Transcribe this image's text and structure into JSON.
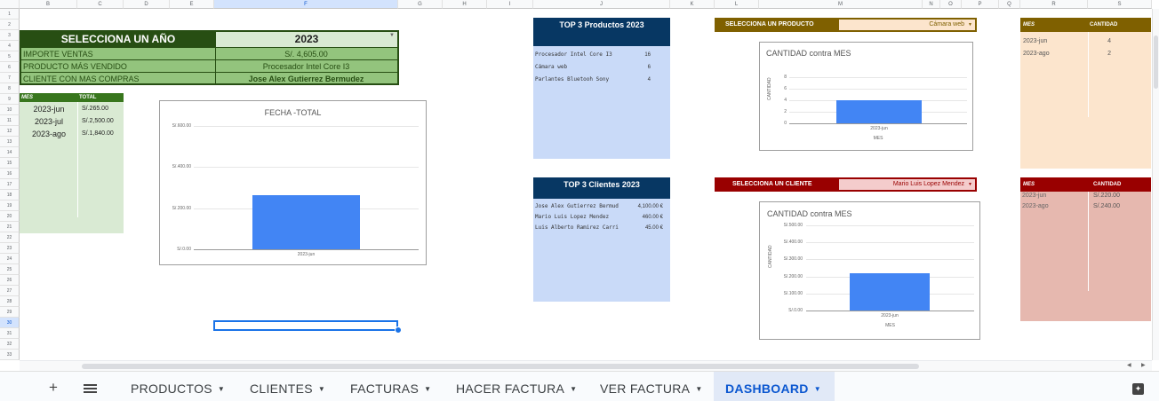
{
  "columns": [
    "B",
    "C",
    "D",
    "E",
    "F",
    "G",
    "H",
    "I",
    "J",
    "K",
    "L",
    "M",
    "N",
    "O",
    "P",
    "Q",
    "R",
    "S"
  ],
  "rows": [
    "1",
    "2",
    "3",
    "4",
    "5",
    "6",
    "7",
    "8",
    "9",
    "10",
    "11",
    "12",
    "13",
    "14",
    "15",
    "16",
    "17",
    "18",
    "19",
    "20",
    "21",
    "22",
    "23",
    "24",
    "25",
    "26",
    "27",
    "28",
    "29",
    "30",
    "31",
    "32",
    "33"
  ],
  "year_table": {
    "header_label": "SELECCIONA UN AÑO",
    "year_value": "2023",
    "rows": [
      {
        "label": "IMPORTE VENTAS",
        "value": "S/. 4,605.00"
      },
      {
        "label": "PRODUCTO MÁS VENDIDO",
        "value": "Procesador Intel Core I3"
      },
      {
        "label": "CLIENTE CON MAS COMPRAS",
        "value": "Jose Alex Gutierrez  Bermudez"
      }
    ]
  },
  "month_totals": {
    "headers": [
      "MES",
      "TOTAL"
    ],
    "rows": [
      [
        "2023-jun",
        "S/.265.00"
      ],
      [
        "2023-jul",
        "S/.2,500.00"
      ],
      [
        "2023-ago",
        "S/.1,840.00"
      ]
    ]
  },
  "chart_fecha": {
    "title": "FECHA -TOTAL",
    "yticks": [
      "S/.600.00",
      "S/.400.00",
      "S/.200.00",
      "S/.0.00"
    ],
    "xlabel_cat": "2023-jun"
  },
  "top_products": {
    "title": "TOP 3 Productos 2023",
    "rows": [
      [
        "Procesador Intel Core I3",
        "16"
      ],
      [
        "Cámara web",
        "6"
      ],
      [
        "Parlantes Bluetooh Sony",
        "4"
      ]
    ]
  },
  "top_clients": {
    "title": "TOP 3 Clientes 2023",
    "rows": [
      [
        "Jose Alex Gutierrez  Bermud",
        "4,100.00 €"
      ],
      [
        "Mario Luis Lopez Mendez",
        "460.00 €"
      ],
      [
        "Luis  Alberto Ramirez Carri",
        "45.00 €"
      ]
    ]
  },
  "product_select": {
    "label": "SELECCIONA UN PRODUCTO",
    "value": "Cámara web"
  },
  "client_select": {
    "label": "SELECCIONA UN CLIENTE",
    "value": "Mario Luis Lopez Mendez"
  },
  "chart_product": {
    "title": "CANTIDAD contra MES",
    "yticks": [
      "8",
      "6",
      "4",
      "2",
      "0"
    ],
    "ylabel": "CANTIDAD",
    "xlabel": "MES",
    "cat": "2023-jun"
  },
  "chart_client": {
    "title": "CANTIDAD contra MES",
    "yticks": [
      "S/.500.00",
      "S/.400.00",
      "S/.300.00",
      "S/.200.00",
      "S/.100.00",
      "S/.0.00"
    ],
    "ylabel": "CANTIDAD",
    "xlabel": "MES",
    "cat": "2023-jun"
  },
  "product_qty": {
    "headers": [
      "MES",
      "CANTIDAD"
    ],
    "rows": [
      [
        "2023-jun",
        "4"
      ],
      [
        "2023-ago",
        "2"
      ]
    ]
  },
  "client_qty": {
    "headers": [
      "MES",
      "CANTIDAD"
    ],
    "rows": [
      [
        "2023-jun",
        "S/.220.00"
      ],
      [
        "2023-ago",
        "S/.240.00"
      ]
    ]
  },
  "sheet_tabs": [
    "PRODUCTOS",
    "CLIENTES",
    "FACTURAS",
    "HACER FACTURA",
    "VER FACTURA",
    "DASHBOARD"
  ],
  "chart_data": [
    {
      "type": "bar",
      "title": "FECHA -TOTAL",
      "categories": [
        "2023-jun"
      ],
      "values": [
        265
      ],
      "ylim": [
        0,
        600
      ]
    },
    {
      "type": "bar",
      "title": "CANTIDAD contra MES",
      "categories": [
        "2023-jun"
      ],
      "values": [
        4
      ],
      "xlabel": "MES",
      "ylabel": "CANTIDAD",
      "ylim": [
        0,
        8
      ]
    },
    {
      "type": "bar",
      "title": "CANTIDAD contra MES",
      "categories": [
        "2023-jun"
      ],
      "values": [
        220
      ],
      "xlabel": "MES",
      "ylabel": "CANTIDAD",
      "ylim": [
        0,
        500
      ]
    }
  ]
}
